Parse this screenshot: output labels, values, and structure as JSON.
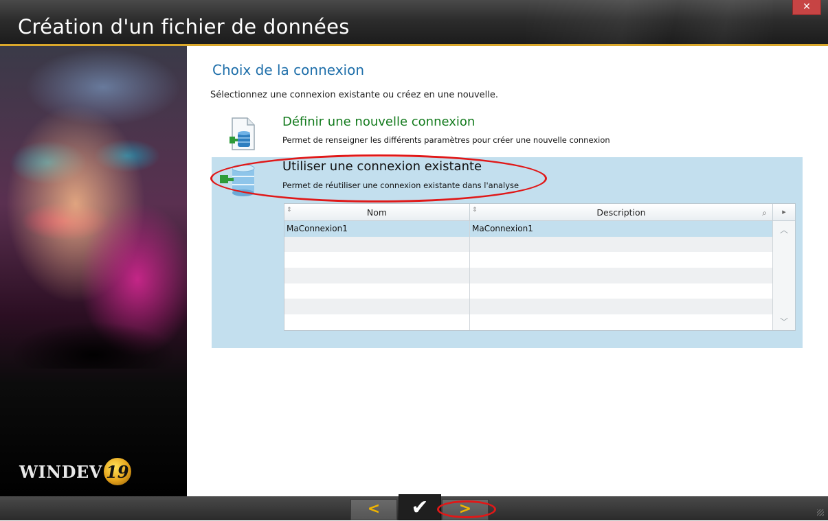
{
  "window": {
    "title": "Création d'un fichier de données",
    "close_label": "✕"
  },
  "sidebar": {
    "logo_text": "WINDEV",
    "logo_version": "19"
  },
  "page": {
    "heading": "Choix de la connexion",
    "subtitle": "Sélectionnez une connexion existante ou créez en une nouvelle."
  },
  "options": [
    {
      "title": "Définir une nouvelle connexion",
      "description": "Permet de renseigner les différents paramètres pour créer une nouvelle connexion",
      "icon": "database-new-icon",
      "selected": false
    },
    {
      "title": "Utiliser une connexion existante",
      "description": "Permet de réutiliser une connexion existante dans l'analyse",
      "icon": "database-existing-icon",
      "selected": true
    }
  ],
  "table": {
    "columns": [
      "Nom",
      "Description"
    ],
    "rows": [
      [
        "MaConnexion1",
        "MaConnexion1"
      ],
      [
        "",
        ""
      ],
      [
        "",
        ""
      ],
      [
        "",
        ""
      ],
      [
        "",
        ""
      ],
      [
        "",
        ""
      ],
      [
        "",
        ""
      ]
    ],
    "selected_row": 0
  },
  "nav": {
    "prev_label": "<",
    "finish_label": "✔",
    "next_label": ">"
  },
  "colors": {
    "accent_gold": "#d9a72b",
    "selected_bg": "#c3dfee",
    "heading_blue": "#1f6faa",
    "option_green": "#127a1c",
    "annotation_red": "#e01818"
  }
}
